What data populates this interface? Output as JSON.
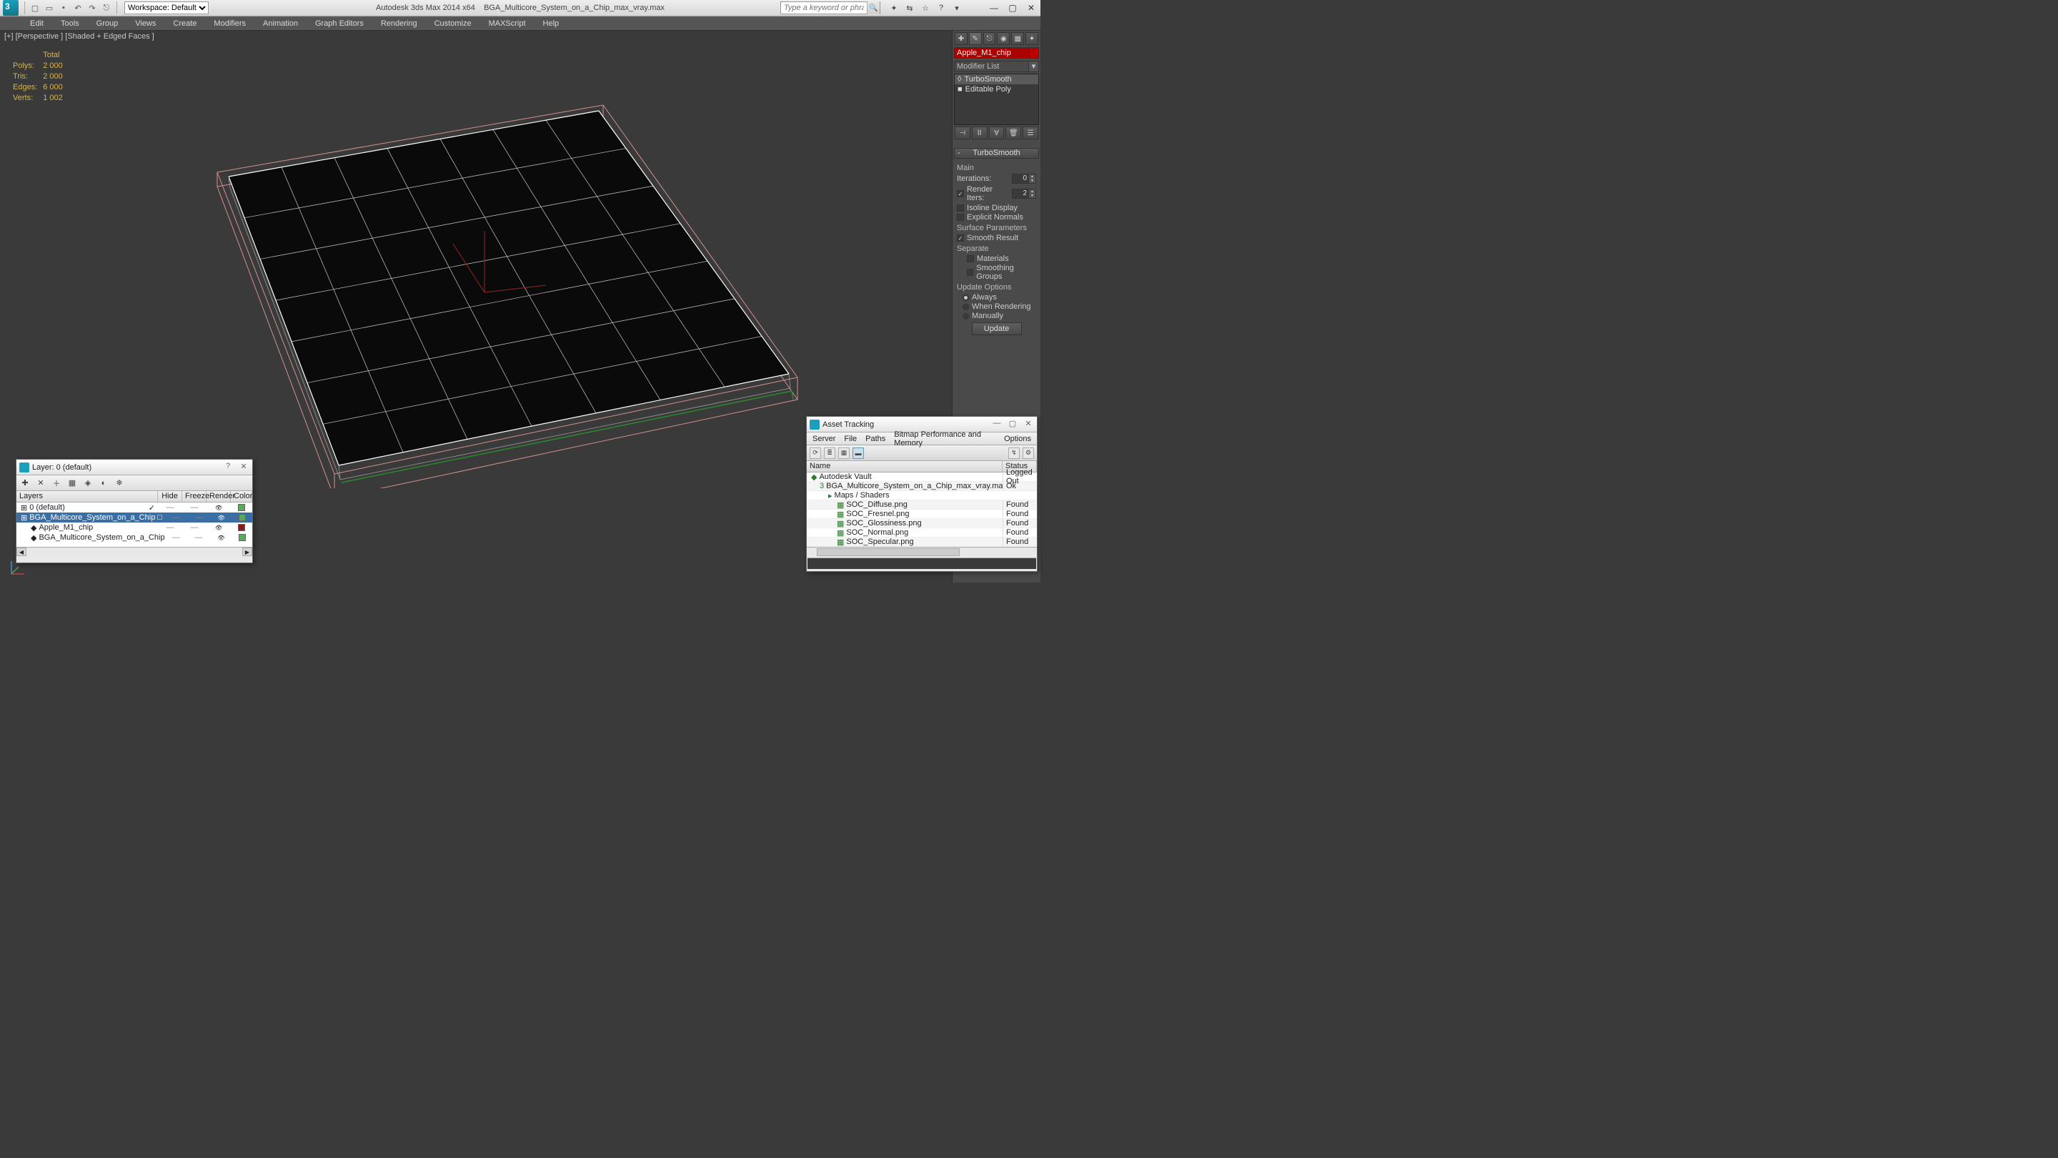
{
  "app": {
    "title": "Autodesk 3ds Max 2014 x64",
    "document": "BGA_Multicore_System_on_a_Chip_max_vray.max",
    "workspace_label": "Workspace: Default",
    "search_placeholder": "Type a keyword or phrase"
  },
  "menu": [
    "Edit",
    "Tools",
    "Group",
    "Views",
    "Create",
    "Modifiers",
    "Animation",
    "Graph Editors",
    "Rendering",
    "Customize",
    "MAXScript",
    "Help"
  ],
  "viewport_label": "[+] [Perspective ] [Shaded + Edged Faces ]",
  "stats": {
    "header": "Total",
    "rows": [
      {
        "label": "Polys:",
        "value": "2 000"
      },
      {
        "label": "Tris:",
        "value": "2 000"
      },
      {
        "label": "Edges:",
        "value": "6 000"
      },
      {
        "label": "Verts:",
        "value": "1 002"
      }
    ]
  },
  "cmd": {
    "object_name": "Apple_M1_chip",
    "modifier_list_label": "Modifier List",
    "stack": [
      {
        "label": "TurboSmooth",
        "bulb": "◊"
      },
      {
        "label": "Editable Poly",
        "bulb": "■"
      }
    ],
    "turbosmooth": {
      "rollout_title": "TurboSmooth",
      "section_main": "Main",
      "iterations_label": "Iterations:",
      "iterations_value": "0",
      "render_iters_label": "Render Iters:",
      "render_iters_value": "2",
      "render_iters_checked": true,
      "isoline_label": "Isoline Display",
      "explicit_label": "Explicit Normals",
      "surface_params": "Surface Parameters",
      "smooth_result": "Smooth Result",
      "separate": "Separate",
      "materials": "Materials",
      "smoothing_groups": "Smoothing Groups",
      "update_options": "Update Options",
      "radio": [
        "Always",
        "When Rendering",
        "Manually"
      ],
      "radio_selected": "Always",
      "update_button": "Update"
    }
  },
  "layer_window": {
    "title": "Layer: 0 (default)",
    "columns": {
      "name": "Layers",
      "hide": "Hide",
      "freeze": "Freeze",
      "render": "Render",
      "color": "Color"
    },
    "rows": [
      {
        "name": "0 (default)",
        "indent": 0,
        "icon": "⊞",
        "check": true,
        "color": "#5aa85a",
        "selected": false
      },
      {
        "name": "BGA_Multicore_System_on_a_Chip",
        "indent": 0,
        "icon": "⊞",
        "check": false,
        "boxy": true,
        "color": "#5aa85a",
        "selected": true
      },
      {
        "name": "Apple_M1_chip",
        "indent": 1,
        "icon": "◆",
        "check": false,
        "color": "#8a1a1a",
        "selected": false
      },
      {
        "name": "BGA_Multicore_System_on_a_Chip",
        "indent": 1,
        "icon": "◆",
        "check": false,
        "color": "#5aa85a",
        "selected": false
      }
    ]
  },
  "asset_window": {
    "title": "Asset Tracking",
    "menu": [
      "Server",
      "File",
      "Paths",
      "Bitmap Performance and Memory",
      "Options"
    ],
    "columns": {
      "name": "Name",
      "status": "Status"
    },
    "rows": [
      {
        "name": "Autodesk Vault",
        "status": "Logged Out",
        "indent": 0,
        "icon": "◆",
        "alt": false
      },
      {
        "name": "BGA_Multicore_System_on_a_Chip_max_vray.max",
        "status": "Ok",
        "indent": 1,
        "icon": "3",
        "alt": true
      },
      {
        "name": "Maps / Shaders",
        "status": "",
        "indent": 2,
        "icon": "▸",
        "alt": false
      },
      {
        "name": "SOC_Diffuse.png",
        "status": "Found",
        "indent": 3,
        "icon": "▦",
        "alt": true
      },
      {
        "name": "SOC_Fresnel.png",
        "status": "Found",
        "indent": 3,
        "icon": "▦",
        "alt": false
      },
      {
        "name": "SOC_Glossiness.png",
        "status": "Found",
        "indent": 3,
        "icon": "▦",
        "alt": true
      },
      {
        "name": "SOC_Normal.png",
        "status": "Found",
        "indent": 3,
        "icon": "▦",
        "alt": false
      },
      {
        "name": "SOC_Specular.png",
        "status": "Found",
        "indent": 3,
        "icon": "▦",
        "alt": true
      }
    ]
  }
}
